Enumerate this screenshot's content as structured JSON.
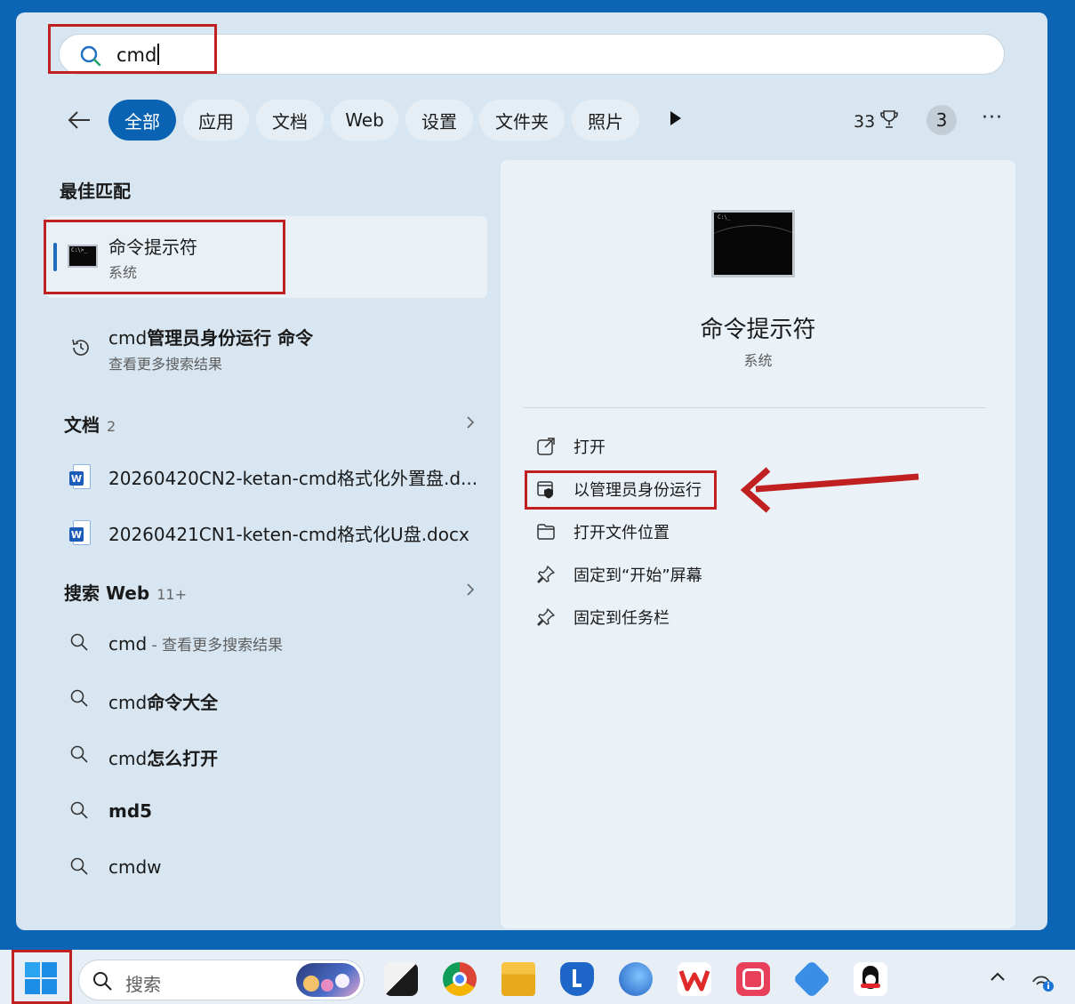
{
  "search": {
    "query": "cmd"
  },
  "filters": {
    "chips": [
      "全部",
      "应用",
      "文档",
      "Web",
      "设置",
      "文件夹",
      "照片"
    ],
    "points": "33",
    "badge": "3",
    "more": "···"
  },
  "best_match": {
    "heading": "最佳匹配",
    "title": "命令提示符",
    "subtitle": "系统"
  },
  "history": {
    "prefix": "cmd",
    "bold": "管理员身份运行 命令",
    "subtitle": "查看更多搜索结果"
  },
  "documents": {
    "heading": "文档",
    "count": "2",
    "items": [
      "20260420CN2-ketan-cmd格式化外置盘.d...",
      "20260421CN1-keten-cmd格式化U盘.docx"
    ]
  },
  "web": {
    "heading": "搜索 Web",
    "count": "11+",
    "items": [
      {
        "prefix": "cmd",
        "bold": "",
        "hint": " - 查看更多搜索结果"
      },
      {
        "prefix": "cmd",
        "bold": "命令大全",
        "hint": ""
      },
      {
        "prefix": "cmd",
        "bold": "怎么打开",
        "hint": ""
      },
      {
        "prefix": "",
        "bold": "md5",
        "hint": ""
      },
      {
        "prefix": "cmdw",
        "bold": "",
        "hint": ""
      }
    ]
  },
  "preview": {
    "title": "命令提示符",
    "subtitle": "系统",
    "actions": [
      "打开",
      "以管理员身份运行",
      "打开文件位置",
      "固定到“开始”屏幕",
      "固定到任务栏"
    ]
  },
  "taskbar": {
    "search_placeholder": "搜索"
  },
  "colors": {
    "accent": "#0a63b2",
    "highlight_red": "#c0201f"
  },
  "icons": [
    "search-icon",
    "back-arrow-icon",
    "play-icon",
    "trophy-icon",
    "history-icon",
    "word-doc-icon",
    "open-external-icon",
    "shield-admin-icon",
    "folder-icon",
    "pin-icon",
    "windows-logo-icon",
    "chevron-up-icon",
    "network-icon"
  ]
}
